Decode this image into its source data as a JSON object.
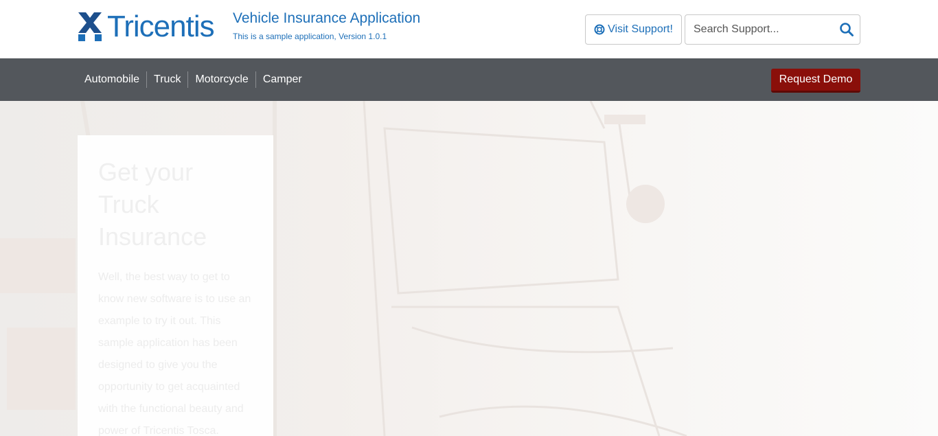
{
  "header": {
    "logo_text": "Tricentis",
    "app_title": "Vehicle Insurance Application",
    "app_subtitle": "This is a sample application, Version 1.0.1",
    "support_button_label": "Visit Support!",
    "search_placeholder": "Search Support..."
  },
  "nav": {
    "items": [
      {
        "label": "Automobile"
      },
      {
        "label": "Truck"
      },
      {
        "label": "Motorcycle"
      },
      {
        "label": "Camper"
      }
    ],
    "demo_button_label": "Request Demo"
  },
  "hero": {
    "heading": "Get your Truck Insurance",
    "text": "Well, the best way to get to know new software is to use an example to try it out. This sample application has been designed to give you the opportunity to get acquainted with the functional beauty and power of Tricentis Tosca."
  },
  "colors": {
    "brand_blue": "#1d6fb8",
    "navbar_bg": "#53575c",
    "demo_button_bg": "#8a0f0a"
  },
  "icons": {
    "logo": "tricentis-x-logo",
    "support": "lifebuoy-icon",
    "search": "magnifier-icon"
  }
}
